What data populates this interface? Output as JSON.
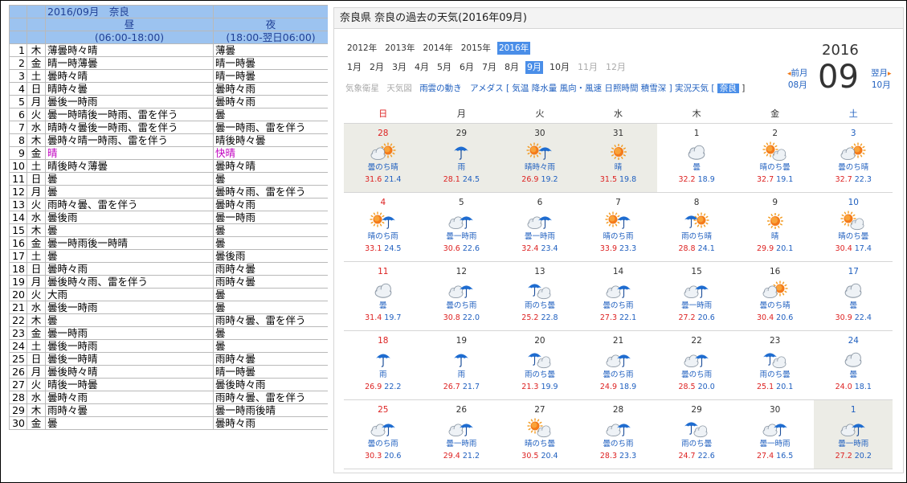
{
  "sheet": {
    "title": "2016/09月　奈良",
    "day_header": "昼",
    "night_header": "夜",
    "day_sub": "(06:00-18:00)",
    "night_sub": "(18:00-翌日06:00)",
    "rows": [
      {
        "n": "1",
        "wd": "木",
        "day": "薄曇時々晴",
        "night": "薄曇"
      },
      {
        "n": "2",
        "wd": "金",
        "day": "晴一時薄曇",
        "night": "晴一時曇"
      },
      {
        "n": "3",
        "wd": "土",
        "day": "曇時々晴",
        "night": "晴一時曇"
      },
      {
        "n": "4",
        "wd": "日",
        "day": "晴時々曇",
        "night": "曇時々雨"
      },
      {
        "n": "5",
        "wd": "月",
        "day": "曇後一時雨",
        "night": "曇時々雨"
      },
      {
        "n": "6",
        "wd": "火",
        "day": "曇一時晴後一時雨、雷を伴う",
        "night": "曇"
      },
      {
        "n": "7",
        "wd": "水",
        "day": "晴時々曇後一時雨、雷を伴う",
        "night": "曇一時雨、雷を伴う"
      },
      {
        "n": "8",
        "wd": "木",
        "day": "曇時々晴一時雨、雷を伴う",
        "night": "晴後時々曇"
      },
      {
        "n": "9",
        "wd": "金",
        "day": "晴",
        "night": "快晴",
        "purple": true
      },
      {
        "n": "10",
        "wd": "土",
        "day": "晴後時々薄曇",
        "night": "曇時々晴"
      },
      {
        "n": "11",
        "wd": "日",
        "day": "曇",
        "night": "曇"
      },
      {
        "n": "12",
        "wd": "月",
        "day": "曇",
        "night": "曇時々雨、雷を伴う"
      },
      {
        "n": "13",
        "wd": "火",
        "day": "雨時々曇、雷を伴う",
        "night": "曇時々雨"
      },
      {
        "n": "14",
        "wd": "水",
        "day": "曇後雨",
        "night": "曇一時雨"
      },
      {
        "n": "15",
        "wd": "木",
        "day": "曇",
        "night": "曇"
      },
      {
        "n": "16",
        "wd": "金",
        "day": "曇一時雨後一時晴",
        "night": "曇"
      },
      {
        "n": "17",
        "wd": "土",
        "day": "曇",
        "night": "曇後雨"
      },
      {
        "n": "18",
        "wd": "日",
        "day": "曇時々雨",
        "night": "雨時々曇"
      },
      {
        "n": "19",
        "wd": "月",
        "day": "曇後時々雨、雷を伴う",
        "night": "雨時々曇"
      },
      {
        "n": "20",
        "wd": "火",
        "day": "大雨",
        "night": "曇"
      },
      {
        "n": "21",
        "wd": "水",
        "day": "曇後一時雨",
        "night": "曇"
      },
      {
        "n": "22",
        "wd": "木",
        "day": "曇",
        "night": "雨時々曇、雷を伴う"
      },
      {
        "n": "23",
        "wd": "金",
        "day": "曇一時雨",
        "night": "曇"
      },
      {
        "n": "24",
        "wd": "土",
        "day": "曇後一時雨",
        "night": "曇"
      },
      {
        "n": "25",
        "wd": "日",
        "day": "曇後一時晴",
        "night": "雨時々曇"
      },
      {
        "n": "26",
        "wd": "月",
        "day": "曇後時々晴",
        "night": "晴一時曇"
      },
      {
        "n": "27",
        "wd": "火",
        "day": "晴後一時曇",
        "night": "曇後時々雨"
      },
      {
        "n": "28",
        "wd": "水",
        "day": "曇時々雨",
        "night": "雨時々曇、雷を伴う"
      },
      {
        "n": "29",
        "wd": "木",
        "day": "雨時々曇",
        "night": "曇一時雨後晴"
      },
      {
        "n": "30",
        "wd": "金",
        "day": "曇",
        "night": "曇時々雨"
      }
    ]
  },
  "panel": {
    "title": "奈良県 奈良の過去の天気(2016年09月)",
    "years": [
      "2012年",
      "2013年",
      "2014年",
      "2015年",
      "2016年"
    ],
    "selected_year": "2016年",
    "months": [
      "1月",
      "2月",
      "3月",
      "4月",
      "5月",
      "6月",
      "7月",
      "8月",
      "9月",
      "10月",
      "11月",
      "12月"
    ],
    "selected_month": "9月",
    "dim_months": [
      "11月",
      "12月"
    ],
    "links_dim": [
      "気象衛星",
      "天気図"
    ],
    "links_main": "雨雲の動き　アメダス [ 気温 降水量 風向・風速 日照時間 積雪深 ] 実況天気 [",
    "links_badge": "奈良",
    "links_end": "]",
    "year_big": "2016",
    "month_big": "09",
    "prev_label": "前月",
    "prev_month": "08月",
    "next_label": "翌月",
    "next_month": "10月",
    "arrow_left": "◂",
    "arrow_right": "▸",
    "weekdays": [
      "日",
      "月",
      "火",
      "水",
      "木",
      "金",
      "土"
    ]
  },
  "colors": {
    "header_bg": "#9cc3f0",
    "selected": "#4a8ee8",
    "high_temp": "#dd2222",
    "low_temp": "#1f5fbf",
    "outside_month": "#ecece6"
  },
  "calendar": [
    [
      {
        "d": "28",
        "w": "曇のち晴",
        "hi": "31.6",
        "lo": "21.4",
        "icon": "cloud-sun-icon",
        "out": true
      },
      {
        "d": "29",
        "w": "雨",
        "hi": "28.1",
        "lo": "24.5",
        "icon": "umbrella-icon",
        "out": true
      },
      {
        "d": "30",
        "w": "晴時々雨",
        "hi": "26.9",
        "lo": "19.2",
        "icon": "sun-umbrella-icon",
        "out": true
      },
      {
        "d": "31",
        "w": "晴",
        "hi": "31.5",
        "lo": "19.8",
        "icon": "sun-icon",
        "out": true
      },
      {
        "d": "1",
        "w": "曇",
        "hi": "32.2",
        "lo": "18.9",
        "icon": "cloud-icon"
      },
      {
        "d": "2",
        "w": "晴のち曇",
        "hi": "32.7",
        "lo": "19.1",
        "icon": "sun-cloud-icon"
      },
      {
        "d": "3",
        "w": "曇のち晴",
        "hi": "32.7",
        "lo": "22.3",
        "icon": "cloud-sun-icon"
      }
    ],
    [
      {
        "d": "4",
        "w": "晴のち雨",
        "hi": "33.1",
        "lo": "24.5",
        "icon": "sun-umbrella-icon"
      },
      {
        "d": "5",
        "w": "曇一時雨",
        "hi": "30.6",
        "lo": "22.6",
        "icon": "cloud-umbrella-icon"
      },
      {
        "d": "6",
        "w": "曇一時雨",
        "hi": "32.4",
        "lo": "23.4",
        "icon": "cloud-umbrella-icon"
      },
      {
        "d": "7",
        "w": "晴のち雨",
        "hi": "33.9",
        "lo": "23.3",
        "icon": "sun-umbrella-icon"
      },
      {
        "d": "8",
        "w": "雨のち晴",
        "hi": "28.8",
        "lo": "24.1",
        "icon": "umbrella-sun-icon"
      },
      {
        "d": "9",
        "w": "晴",
        "hi": "29.9",
        "lo": "20.1",
        "icon": "sun-icon"
      },
      {
        "d": "10",
        "w": "晴のち曇",
        "hi": "30.4",
        "lo": "17.4",
        "icon": "sun-cloud-icon"
      }
    ],
    [
      {
        "d": "11",
        "w": "曇",
        "hi": "31.4",
        "lo": "19.7",
        "icon": "cloud-icon"
      },
      {
        "d": "12",
        "w": "曇のち雨",
        "hi": "30.8",
        "lo": "22.0",
        "icon": "cloud-umbrella-icon"
      },
      {
        "d": "13",
        "w": "雨のち曇",
        "hi": "25.2",
        "lo": "22.8",
        "icon": "umbrella-cloud-icon"
      },
      {
        "d": "14",
        "w": "曇のち雨",
        "hi": "27.3",
        "lo": "22.1",
        "icon": "cloud-umbrella-icon"
      },
      {
        "d": "15",
        "w": "曇一時雨",
        "hi": "27.2",
        "lo": "20.6",
        "icon": "cloud-umbrella-icon"
      },
      {
        "d": "16",
        "w": "曇のち晴",
        "hi": "30.4",
        "lo": "20.6",
        "icon": "cloud-sun-icon"
      },
      {
        "d": "17",
        "w": "曇",
        "hi": "30.9",
        "lo": "22.4",
        "icon": "cloud-icon"
      }
    ],
    [
      {
        "d": "18",
        "w": "雨",
        "hi": "26.9",
        "lo": "22.2",
        "icon": "umbrella-icon"
      },
      {
        "d": "19",
        "w": "雨",
        "hi": "26.7",
        "lo": "21.7",
        "icon": "umbrella-icon"
      },
      {
        "d": "20",
        "w": "雨のち曇",
        "hi": "21.3",
        "lo": "19.9",
        "icon": "umbrella-cloud-icon"
      },
      {
        "d": "21",
        "w": "曇のち雨",
        "hi": "24.9",
        "lo": "18.9",
        "icon": "cloud-umbrella-icon"
      },
      {
        "d": "22",
        "w": "曇のち雨",
        "hi": "28.5",
        "lo": "20.0",
        "icon": "cloud-umbrella-icon"
      },
      {
        "d": "23",
        "w": "雨のち曇",
        "hi": "25.1",
        "lo": "20.1",
        "icon": "umbrella-cloud-icon"
      },
      {
        "d": "24",
        "w": "曇",
        "hi": "24.0",
        "lo": "18.1",
        "icon": "cloud-icon"
      }
    ],
    [
      {
        "d": "25",
        "w": "曇のち雨",
        "hi": "30.3",
        "lo": "20.6",
        "icon": "cloud-umbrella-icon"
      },
      {
        "d": "26",
        "w": "曇一時雨",
        "hi": "29.4",
        "lo": "21.2",
        "icon": "cloud-umbrella-icon"
      },
      {
        "d": "27",
        "w": "晴のち曇",
        "hi": "30.5",
        "lo": "20.4",
        "icon": "sun-cloud-icon"
      },
      {
        "d": "28",
        "w": "曇のち雨",
        "hi": "28.3",
        "lo": "23.3",
        "icon": "cloud-umbrella-icon"
      },
      {
        "d": "29",
        "w": "雨のち曇",
        "hi": "24.7",
        "lo": "22.6",
        "icon": "umbrella-cloud-icon"
      },
      {
        "d": "30",
        "w": "曇一時雨",
        "hi": "27.4",
        "lo": "16.5",
        "icon": "cloud-umbrella-icon"
      },
      {
        "d": "1",
        "w": "曇一時雨",
        "hi": "27.2",
        "lo": "20.2",
        "icon": "cloud-umbrella-icon",
        "out": true
      }
    ]
  ]
}
